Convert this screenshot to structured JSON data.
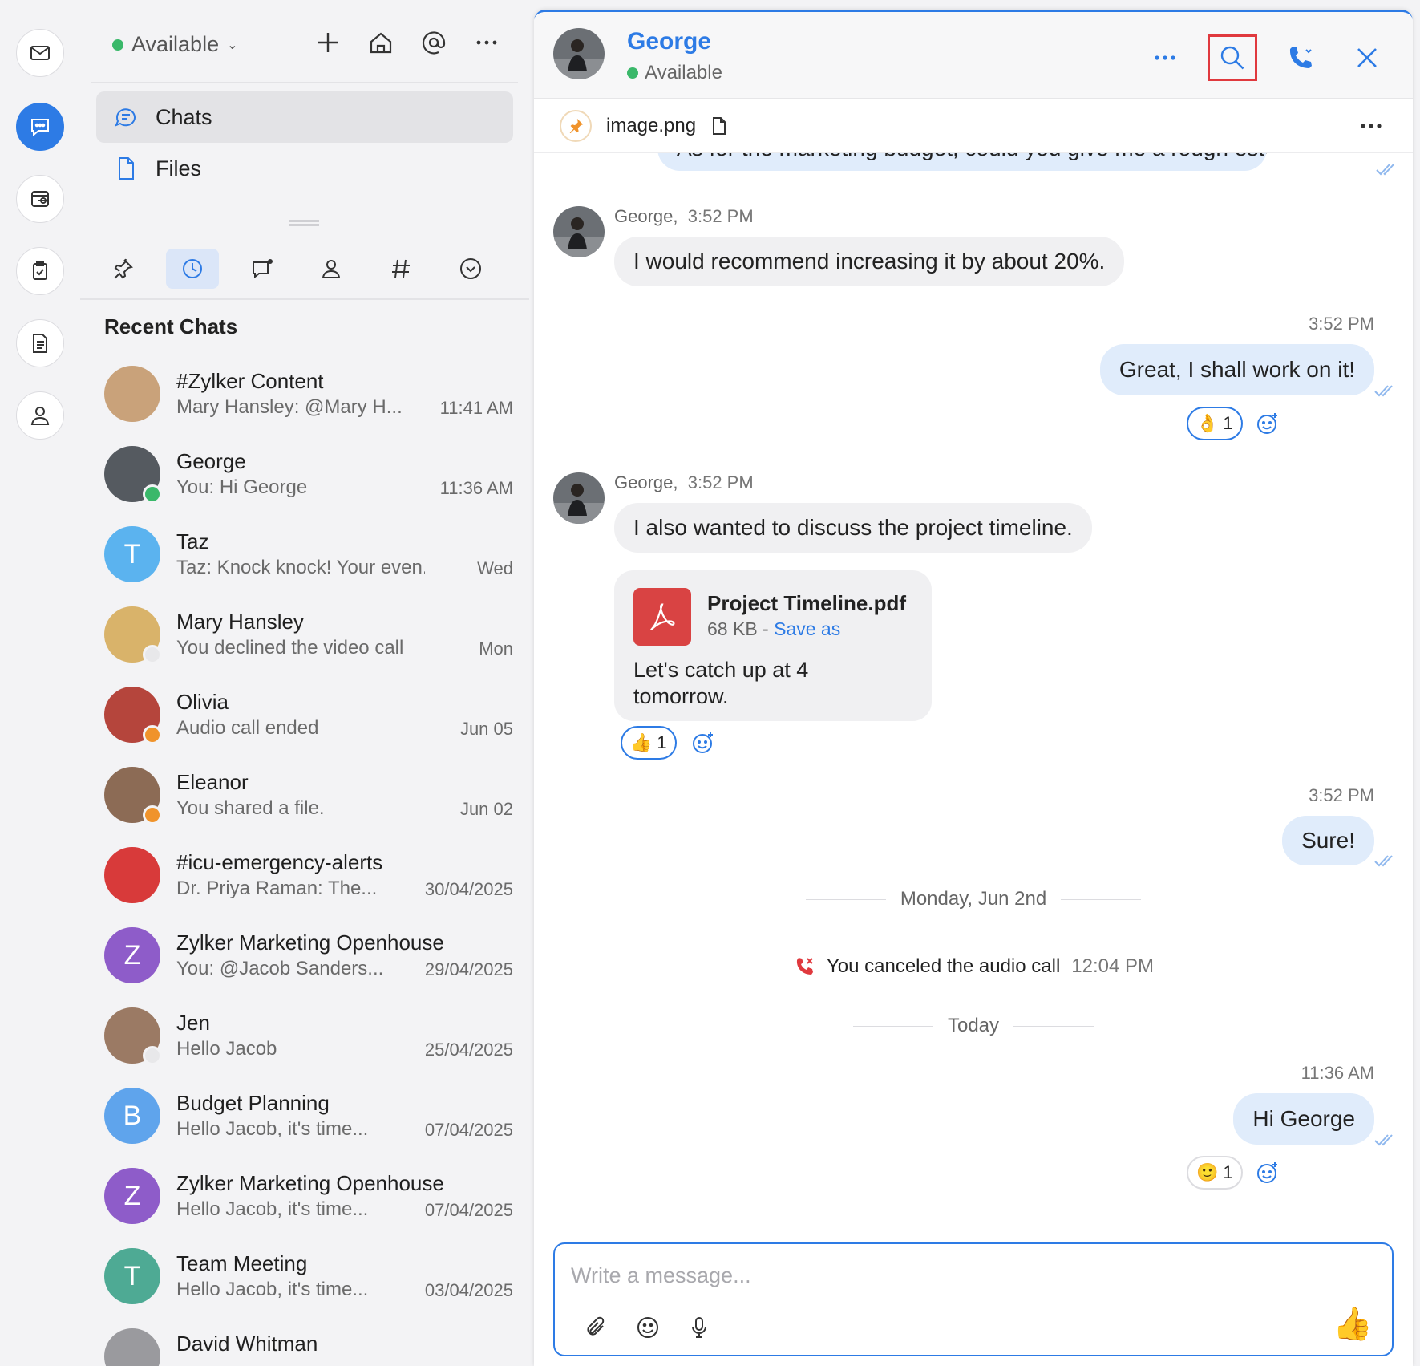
{
  "rail": {
    "items": [
      "mail-icon",
      "chat-icon",
      "inbox-icon",
      "tasks-icon",
      "notes-icon",
      "contacts-icon"
    ],
    "accent": "#2d7be5"
  },
  "sidebar": {
    "status": "Available",
    "nav": [
      {
        "label": "Chats"
      },
      {
        "label": "Files"
      }
    ],
    "recent_title": "Recent Chats",
    "chats": [
      {
        "name": "#Zylker Content",
        "preview": "Mary Hansley: @Mary H...",
        "time": "11:41 AM",
        "initial": "",
        "color": "#c9a27a",
        "presence": ""
      },
      {
        "name": "George",
        "preview": "You: Hi George",
        "time": "11:36 AM",
        "initial": "",
        "color": "#555a60",
        "presence": "#3ab86a"
      },
      {
        "name": "Taz",
        "preview": "Taz: Knock knock! Your even...",
        "time": "Wed",
        "initial": "T",
        "color": "#5bb3ef",
        "presence": ""
      },
      {
        "name": "Mary  Hansley",
        "preview": "You declined the video call",
        "time": "Mon",
        "initial": "",
        "color": "#d9b36a",
        "presence": "#e8e8ea"
      },
      {
        "name": "Olivia",
        "preview": "Audio call ended",
        "time": "Jun 05",
        "initial": "",
        "color": "#b5453c",
        "presence": "#f0932b"
      },
      {
        "name": "Eleanor",
        "preview": "You shared a file.",
        "time": "Jun 02",
        "initial": "",
        "color": "#8c6b55",
        "presence": "#f0932b"
      },
      {
        "name": "#icu-emergency-alerts",
        "preview": "Dr. Priya Raman: The...",
        "time": "30/04/2025",
        "initial": "",
        "color": "#d83a3a",
        "presence": ""
      },
      {
        "name": "Zylker Marketing Openhouse",
        "preview": "You: @Jacob Sanders...",
        "time": "29/04/2025",
        "initial": "Z",
        "color": "#8e5cc9",
        "presence": ""
      },
      {
        "name": "Jen",
        "preview": "Hello Jacob",
        "time": "25/04/2025",
        "initial": "",
        "color": "#9b7a64",
        "presence": "#e8e8ea"
      },
      {
        "name": "Budget Planning",
        "preview": "Hello Jacob, it's time...",
        "time": "07/04/2025",
        "initial": "B",
        "color": "#5fa4ec",
        "presence": ""
      },
      {
        "name": "Zylker Marketing Openhouse",
        "preview": "Hello Jacob, it's time...",
        "time": "07/04/2025",
        "initial": "Z",
        "color": "#8e5cc9",
        "presence": ""
      },
      {
        "name": "Team Meeting",
        "preview": "Hello Jacob, it's time...",
        "time": "03/04/2025",
        "initial": "T",
        "color": "#4eaa94",
        "presence": ""
      },
      {
        "name": "David Whitman",
        "preview": "",
        "time": "",
        "initial": "",
        "color": "#9a9a9e",
        "presence": ""
      }
    ]
  },
  "chat": {
    "name": "George",
    "status": "Available",
    "pinned": "image.png",
    "cut_message": "As for the marketing budget, could you give me a rough estimate?",
    "messages": {
      "m1_sender": "George,",
      "m1_time": "3:52 PM",
      "m1_text": "I would recommend increasing it by about 20%.",
      "m2_time": "3:52 PM",
      "m2_text": "Great, I shall work on it!",
      "m2_reaction": "👌",
      "m2_reaction_count": "1",
      "m3_sender": "George,",
      "m3_time": "3:52 PM",
      "m3_text": "I also wanted to discuss the project timeline.",
      "file_name": "Project Timeline.pdf",
      "file_size": "68 KB",
      "file_sep": " - ",
      "file_action": "Save as",
      "file_text": "Let's catch up at 4 tomorrow.",
      "m3_reaction": "👍",
      "m3_reaction_count": "1",
      "m4_time": "3:52 PM",
      "m4_text": "Sure!",
      "date1": "Monday, Jun 2nd",
      "call_text": "You canceled the audio call",
      "call_time": "12:04 PM",
      "date2": "Today",
      "m5_time": "11:36 AM",
      "m5_text": "Hi George",
      "m5_reaction": "🙂",
      "m5_reaction_count": "1"
    },
    "composer_placeholder": "Write a message...",
    "send_icon": "👍"
  }
}
